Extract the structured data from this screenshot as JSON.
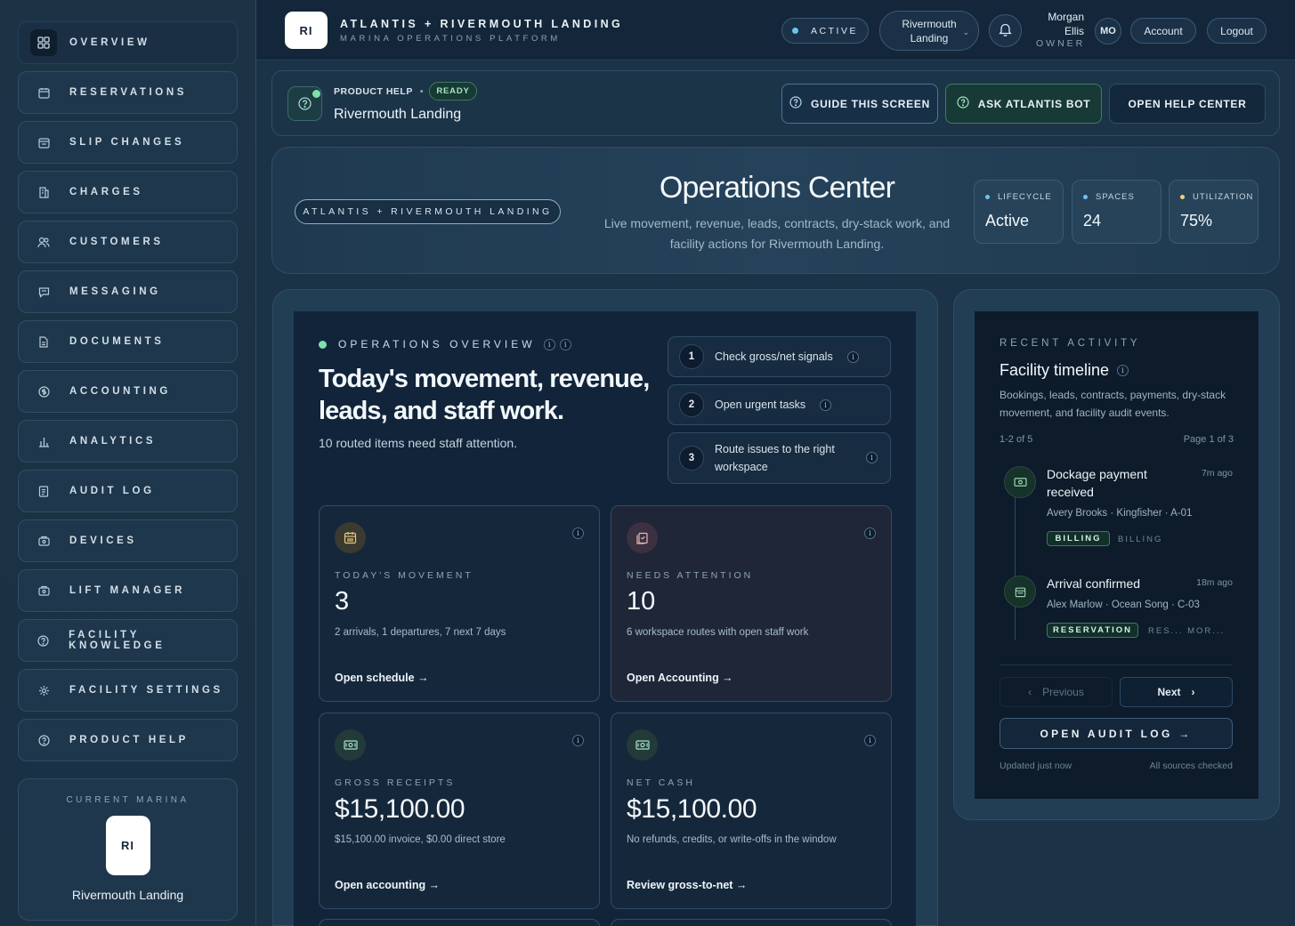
{
  "sidebar": {
    "items": [
      {
        "label": "Overview",
        "icon": "grid-icon"
      },
      {
        "label": "Reservations",
        "icon": "calendar-icon"
      },
      {
        "label": "Slip changes",
        "icon": "calendar-swap-icon"
      },
      {
        "label": "Charges",
        "icon": "receipt-icon"
      },
      {
        "label": "Customers",
        "icon": "users-icon"
      },
      {
        "label": "Messaging",
        "icon": "chat-icon"
      },
      {
        "label": "Documents",
        "icon": "document-icon"
      },
      {
        "label": "Accounting",
        "icon": "dollar-circle-icon"
      },
      {
        "label": "Analytics",
        "icon": "bar-chart-icon"
      },
      {
        "label": "Audit log",
        "icon": "log-icon"
      },
      {
        "label": "Devices",
        "icon": "device-icon"
      },
      {
        "label": "Lift manager",
        "icon": "lift-icon"
      },
      {
        "label": "Facility knowledge",
        "icon": "help-circle-icon"
      },
      {
        "label": "Facility settings",
        "icon": "gear-icon"
      },
      {
        "label": "Product help",
        "icon": "help-circle-icon"
      }
    ],
    "current_marina": {
      "caption": "CURRENT MARINA",
      "initials": "RI",
      "name": "Rivermouth Landing"
    }
  },
  "topbar": {
    "logo_initials": "RI",
    "title": "ATLANTIS + RIVERMOUTH LANDING",
    "subtitle": "MARINA OPERATIONS PLATFORM",
    "status": "ACTIVE",
    "marina_select": {
      "line1": "Rivermouth",
      "line2": "Landing"
    },
    "user": {
      "first": "Morgan",
      "last": "Ellis",
      "role": "OWNER",
      "initials": "MO"
    },
    "account_label": "Account",
    "logout_label": "Logout"
  },
  "help_bar": {
    "kicker": "PRODUCT HELP",
    "badge": "READY",
    "title": "Rivermouth Landing",
    "guide_label": "GUIDE THIS SCREEN",
    "bot_label": "ASK ATLANTIS BOT",
    "center_label": "OPEN HELP CENTER"
  },
  "hero": {
    "chip": "ATLANTIS + RIVERMOUTH LANDING",
    "title": "Operations Center",
    "description": "Live movement, revenue, leads, contracts, dry-stack work, and facility actions for Rivermouth Landing.",
    "stats": [
      {
        "label": "LIFECYCLE",
        "value": "Active",
        "dot_color": "#6fc3ee"
      },
      {
        "label": "SPACES",
        "value": "24",
        "dot_color": "#6fc3ee"
      },
      {
        "label": "UTILIZATION",
        "value": "75%",
        "dot_color": "#f0d37a"
      }
    ]
  },
  "overview": {
    "kicker": "OPERATIONS OVERVIEW",
    "title": "Today's movement, revenue, leads, and staff work.",
    "note": "10 routed items need staff attention.",
    "steps": [
      {
        "num": "1",
        "text": "Check gross/net signals"
      },
      {
        "num": "2",
        "text": "Open urgent tasks"
      },
      {
        "num": "3",
        "text": "Route issues to the right workspace"
      }
    ],
    "metrics": [
      {
        "label": "TODAY'S MOVEMENT",
        "value": "3",
        "sub": "2 arrivals, 1 departures, 7 next 7 days",
        "link": "Open schedule →"
      },
      {
        "label": "NEEDS ATTENTION",
        "value": "10",
        "sub": "6 workspace routes with open staff work",
        "link": "Open Accounting →"
      },
      {
        "label": "GROSS RECEIPTS",
        "value": "$15,100.00",
        "sub": "$15,100.00 invoice, $0.00 direct store",
        "link": "Open accounting →"
      },
      {
        "label": "NET CASH",
        "value": "$15,100.00",
        "sub": "No refunds, credits, or write-offs in the window",
        "link": "Review gross-to-net →"
      }
    ]
  },
  "activity": {
    "kicker": "RECENT ACTIVITY",
    "title": "Facility timeline",
    "description": "Bookings, leads, contracts, payments, dry-stack movement, and facility audit events.",
    "count": "1-2 of 5",
    "page": "Page 1 of 3",
    "events": [
      {
        "title": "Dockage payment received",
        "time": "7m ago",
        "meta": "Avery Brooks · Kingfisher · A-01",
        "tag": "BILLING",
        "tag2": "BILLING"
      },
      {
        "title": "Arrival confirmed",
        "time": "18m ago",
        "meta": "Alex Marlow · Ocean Song · C-03",
        "tag": "RESERVATION",
        "tag2": "RES...  MOR..."
      }
    ],
    "prev_label": "Previous",
    "next_label": "Next",
    "audit_label": "OPEN AUDIT LOG →",
    "updated": "Updated just now",
    "sources": "All sources checked"
  }
}
